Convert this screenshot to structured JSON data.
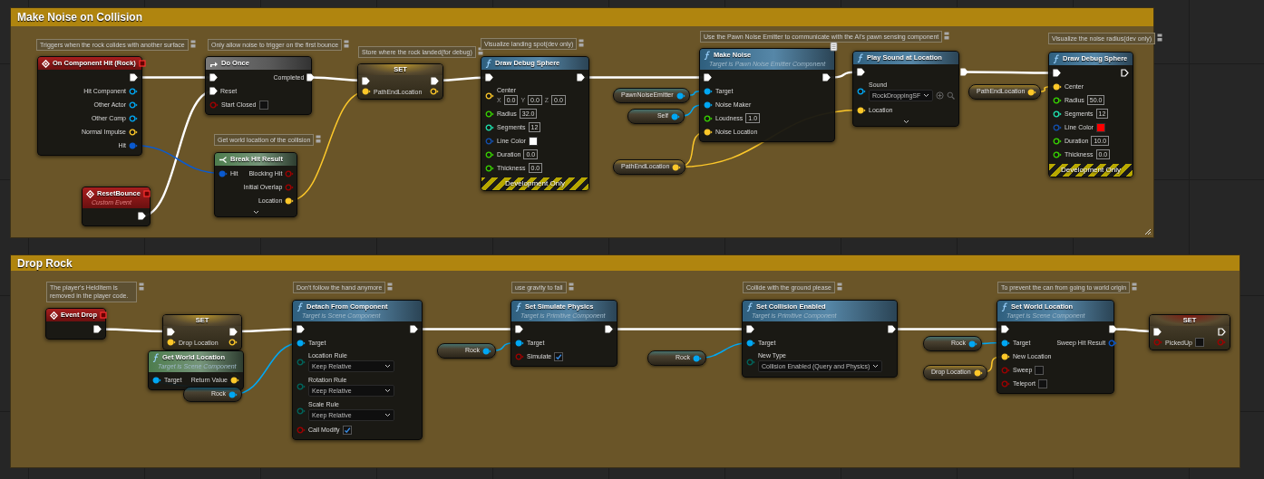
{
  "groups": [
    {
      "title": "Make Noise on Collision",
      "resize_handle": true,
      "comments": [
        {
          "text": "Triggers when the rock colides with another surface"
        },
        {
          "text": "Only allow noise to trigger on the first bounce"
        },
        {
          "text": "Store where the rock landed(for debug)"
        },
        {
          "text": "Visualize landing spot(dev only)"
        },
        {
          "text": "Use the Pawn Noise Emitter to communicate with the AI's pawn sensing component"
        },
        {
          "text": "Visualize the noise radius(dev only)"
        },
        {
          "text": "Get world location of the collision"
        }
      ],
      "nodes": [
        {
          "kind": "event",
          "title": "On Component Hit (Rock)",
          "outputs": [
            {
              "kind": "exec",
              "connected": true
            },
            {
              "kind": "object",
              "label": "Hit Component",
              "connected": false
            },
            {
              "kind": "object",
              "label": "Other Actor",
              "connected": false
            },
            {
              "kind": "object",
              "label": "Other Comp",
              "connected": false
            },
            {
              "kind": "vector",
              "label": "Normal Impulse",
              "connected": false
            },
            {
              "kind": "struct",
              "label": "Hit",
              "connected": true
            }
          ]
        },
        {
          "kind": "event",
          "title": "ResetBounce",
          "subtitle": "Custom Event",
          "outputs": [
            {
              "kind": "exec",
              "connected": true
            }
          ]
        },
        {
          "kind": "macro",
          "title": "Do Once",
          "inputs": [
            {
              "kind": "exec",
              "connected": true
            },
            {
              "kind": "exec",
              "label": "Reset",
              "connected": true
            },
            {
              "kind": "bool",
              "label": "Start Closed",
              "connected": false,
              "checked": false
            }
          ],
          "outputs": [
            {
              "kind": "exec",
              "label": "Completed",
              "connected": true
            }
          ]
        },
        {
          "kind": "break",
          "title": "Break Hit Result",
          "advanced_collapsed": true,
          "inputs": [
            {
              "kind": "struct",
              "label": "Hit",
              "connected": true
            }
          ],
          "outputs": [
            {
              "kind": "bool",
              "label": "Blocking Hit",
              "connected": false
            },
            {
              "kind": "bool",
              "label": "Initial Overlap",
              "connected": false
            },
            {
              "kind": "vector",
              "label": "Location",
              "connected": true
            }
          ]
        },
        {
          "kind": "set",
          "title": "SET",
          "inputs": [
            {
              "kind": "exec",
              "connected": true
            },
            {
              "kind": "vector",
              "label": "PathEndLocation",
              "connected": true
            }
          ],
          "outputs": [
            {
              "kind": "exec",
              "connected": true
            },
            {
              "kind": "vector",
              "connected": false
            }
          ]
        },
        {
          "kind": "function",
          "title": "Draw Debug Sphere",
          "footer": "Development Only",
          "inputs": [
            {
              "kind": "exec",
              "connected": true
            },
            {
              "kind": "vector",
              "label": "Center",
              "connected": false,
              "components": [
                {
                  "axis": "X",
                  "value": "0.0"
                },
                {
                  "axis": "Y",
                  "value": "0.0"
                },
                {
                  "axis": "Z",
                  "value": "0.0"
                }
              ]
            },
            {
              "kind": "float",
              "label": "Radius",
              "connected": false,
              "value": "32.0"
            },
            {
              "kind": "int",
              "label": "Segments",
              "connected": false,
              "value": "12"
            },
            {
              "kind": "color",
              "label": "Line Color",
              "connected": false,
              "color": "#ffffff"
            },
            {
              "kind": "float",
              "label": "Duration",
              "connected": false,
              "value": "0.0"
            },
            {
              "kind": "float",
              "label": "Thickness",
              "connected": false,
              "value": "0.0"
            }
          ],
          "outputs": [
            {
              "kind": "exec",
              "connected": true
            }
          ]
        },
        {
          "kind": "variable",
          "title": "PawnNoiseEmitter",
          "outputs": [
            {
              "kind": "object",
              "connected": true
            }
          ]
        },
        {
          "kind": "variable",
          "title": "Self",
          "outputs": [
            {
              "kind": "object",
              "connected": true
            }
          ]
        },
        {
          "kind": "variable",
          "title": "PathEndLocation",
          "outputs": [
            {
              "kind": "vector",
              "connected": true
            }
          ]
        },
        {
          "kind": "function",
          "title": "Make Noise",
          "subtitle": "Target is Pawn Noise Emitter Component",
          "network_badge": true,
          "inputs": [
            {
              "kind": "exec",
              "connected": true
            },
            {
              "kind": "object",
              "label": "Target",
              "connected": true
            },
            {
              "kind": "object",
              "label": "Noise Maker",
              "connected": true
            },
            {
              "kind": "float",
              "label": "Loudness",
              "connected": false,
              "value": "1.0"
            },
            {
              "kind": "vector",
              "label": "Noise Location",
              "connected": true
            }
          ],
          "outputs": [
            {
              "kind": "exec",
              "connected": true
            }
          ]
        },
        {
          "kind": "function",
          "title": "Play Sound at Location",
          "advanced_collapsed": true,
          "inputs": [
            {
              "kind": "exec",
              "connected": true
            },
            {
              "kind": "object",
              "label": "Sound",
              "connected": false,
              "dropdown": "RockDroppingSF",
              "asset_tools": true
            },
            {
              "kind": "vector",
              "label": "Location",
              "connected": true
            }
          ],
          "outputs": [
            {
              "kind": "exec",
              "connected": true
            }
          ]
        },
        {
          "kind": "variable",
          "title": "PathEndLocation",
          "outputs": [
            {
              "kind": "vector",
              "connected": true
            }
          ]
        },
        {
          "kind": "function",
          "title": "Draw Debug Sphere",
          "footer": "Development Only",
          "inputs": [
            {
              "kind": "exec",
              "connected": true
            },
            {
              "kind": "vector",
              "label": "Center",
              "connected": true
            },
            {
              "kind": "float",
              "label": "Radius",
              "connected": false,
              "value": "50.0"
            },
            {
              "kind": "int",
              "label": "Segments",
              "connected": false,
              "value": "12"
            },
            {
              "kind": "color",
              "label": "Line Color",
              "connected": false,
              "color": "#ff0000"
            },
            {
              "kind": "float",
              "label": "Duration",
              "connected": false,
              "value": "10.0"
            },
            {
              "kind": "float",
              "label": "Thickness",
              "connected": false,
              "value": "0.0"
            }
          ],
          "outputs": [
            {
              "kind": "exec",
              "connected": false
            }
          ]
        }
      ]
    },
    {
      "title": "Drop Rock",
      "comments": [
        {
          "text": "The player's HeldItem is removed in the player code."
        },
        {
          "text": "Don't follow the hand anymore"
        },
        {
          "text": "use gravity to fall"
        },
        {
          "text": "Collide with the ground please"
        },
        {
          "text": "To prevent the can from going to world origin"
        }
      ],
      "nodes": [
        {
          "kind": "event",
          "title": "Event Drop",
          "outputs": [
            {
              "kind": "exec",
              "connected": true
            }
          ]
        },
        {
          "kind": "set",
          "title": "SET",
          "inputs": [
            {
              "kind": "exec",
              "connected": true
            },
            {
              "kind": "vector",
              "label": "Drop Location",
              "connected": true
            }
          ],
          "outputs": [
            {
              "kind": "exec",
              "connected": true
            },
            {
              "kind": "vector",
              "connected": false
            }
          ]
        },
        {
          "kind": "pure",
          "title": "Get World Location",
          "subtitle": "Target is Scene Component",
          "inputs": [
            {
              "kind": "object",
              "label": "Target",
              "connected": true
            }
          ],
          "outputs": [
            {
              "kind": "vector",
              "label": "Return Value",
              "connected": true
            }
          ]
        },
        {
          "kind": "variable",
          "title": "Rock",
          "outputs": [
            {
              "kind": "object",
              "connected": true
            }
          ]
        },
        {
          "kind": "function",
          "title": "Detach From Component",
          "subtitle": "Target is Scene Component",
          "inputs": [
            {
              "kind": "exec",
              "connected": true
            },
            {
              "kind": "object",
              "label": "Target",
              "connected": true
            },
            {
              "kind": "enum",
              "label": "Location Rule",
              "connected": false,
              "dropdown": "Keep Relative"
            },
            {
              "kind": "enum",
              "label": "Rotation Rule",
              "connected": false,
              "dropdown": "Keep Relative"
            },
            {
              "kind": "enum",
              "label": "Scale Rule",
              "connected": false,
              "dropdown": "Keep Relative"
            },
            {
              "kind": "bool",
              "label": "Call Modify",
              "connected": false,
              "checked": true
            }
          ],
          "outputs": [
            {
              "kind": "exec",
              "connected": true
            }
          ]
        },
        {
          "kind": "variable",
          "title": "Rock",
          "outputs": [
            {
              "kind": "object",
              "connected": true
            }
          ]
        },
        {
          "kind": "function",
          "title": "Set Simulate Physics",
          "subtitle": "Target is Primitive Component",
          "inputs": [
            {
              "kind": "exec",
              "connected": true
            },
            {
              "kind": "object",
              "label": "Target",
              "connected": true
            },
            {
              "kind": "bool",
              "label": "Simulate",
              "connected": false,
              "checked": true
            }
          ],
          "outputs": [
            {
              "kind": "exec",
              "connected": true
            }
          ]
        },
        {
          "kind": "variable",
          "title": "Rock",
          "outputs": [
            {
              "kind": "object",
              "connected": true
            }
          ]
        },
        {
          "kind": "function",
          "title": "Set Collision Enabled",
          "subtitle": "Target is Primitive Component",
          "inputs": [
            {
              "kind": "exec",
              "connected": true
            },
            {
              "kind": "object",
              "label": "Target",
              "connected": true
            },
            {
              "kind": "enum",
              "label": "New Type",
              "connected": false,
              "dropdown": "Collision Enabled (Query and Physics)"
            }
          ],
          "outputs": [
            {
              "kind": "exec",
              "connected": true
            }
          ]
        },
        {
          "kind": "variable",
          "title": "Rock",
          "outputs": [
            {
              "kind": "object",
              "connected": true
            }
          ]
        },
        {
          "kind": "variable",
          "title": "Drop Location",
          "outputs": [
            {
              "kind": "vector",
              "connected": true
            }
          ]
        },
        {
          "kind": "function",
          "title": "Set World Location",
          "subtitle": "Target is Scene Component",
          "inputs": [
            {
              "kind": "exec",
              "connected": true
            },
            {
              "kind": "object",
              "label": "Target",
              "connected": true
            },
            {
              "kind": "vector",
              "label": "New Location",
              "connected": true
            },
            {
              "kind": "bool",
              "label": "Sweep",
              "connected": false,
              "checked": false
            },
            {
              "kind": "bool",
              "label": "Teleport",
              "connected": false,
              "checked": false
            }
          ],
          "outputs": [
            {
              "kind": "exec",
              "connected": true
            },
            {
              "kind": "struct",
              "label": "Sweep Hit Result",
              "connected": false
            }
          ]
        },
        {
          "kind": "set",
          "title": "SET",
          "inputs": [
            {
              "kind": "exec",
              "connected": true
            },
            {
              "kind": "bool",
              "label": "PickedUp",
              "connected": false,
              "checked": false
            }
          ],
          "outputs": [
            {
              "kind": "exec",
              "connected": false
            },
            {
              "kind": "bool",
              "connected": false
            }
          ]
        }
      ]
    }
  ]
}
